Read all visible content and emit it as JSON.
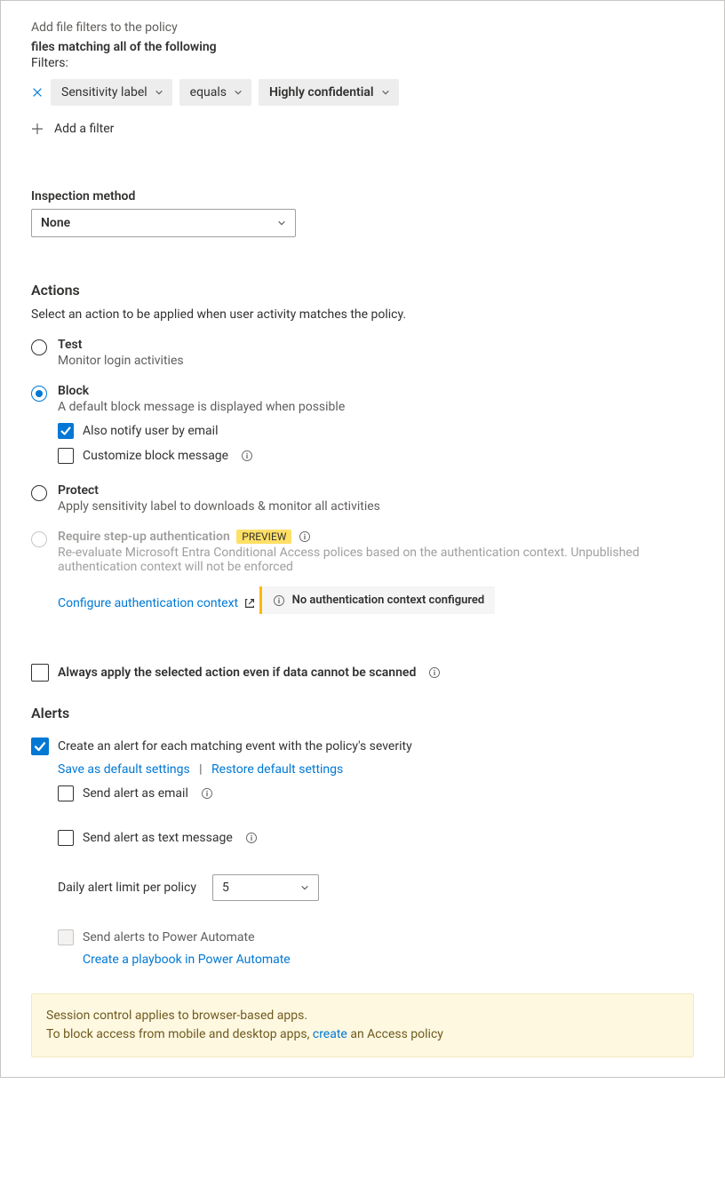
{
  "filters_header": "Add file filters to the policy",
  "filters_match": "files matching all of the following",
  "filters_label": "Filters:",
  "filter": {
    "field": "Sensitivity label",
    "op": "equals",
    "value": "Highly confidential"
  },
  "add_filter": "Add a filter",
  "inspection": {
    "label": "Inspection method",
    "value": "None"
  },
  "actions": {
    "title": "Actions",
    "desc": "Select an action to be applied when user activity matches the policy.",
    "test": {
      "title": "Test",
      "sub": "Monitor login activities"
    },
    "block": {
      "title": "Block",
      "sub": "A default block message is displayed when possible",
      "notify": "Also notify user by email",
      "customize": "Customize block message"
    },
    "protect": {
      "title": "Protect",
      "sub": "Apply sensitivity label to downloads & monitor all activities"
    },
    "stepup": {
      "title": "Require step-up authentication",
      "badge": "PREVIEW",
      "sub": "Re-evaluate Microsoft Entra Conditional Access polices based on the authentication context. Unpublished authentication context will not be enforced",
      "config_link": "Configure authentication context",
      "warn": "No authentication context configured"
    },
    "always_apply": "Always apply the selected action even if data cannot be scanned"
  },
  "alerts": {
    "title": "Alerts",
    "create": "Create an alert for each matching event with the policy's severity",
    "save_default": "Save as default settings",
    "restore_default": "Restore default settings",
    "send_email": "Send alert as email",
    "send_sms": "Send alert as text message",
    "daily_limit": "Daily alert limit per policy",
    "daily_limit_value": "5",
    "power_automate": "Send alerts to Power Automate",
    "playbook_link": "Create a playbook in Power Automate"
  },
  "note": {
    "line1": "Session control applies to browser-based apps.",
    "line2a": "To block access from mobile and desktop apps, ",
    "link": "create",
    "line2b": " an Access policy"
  }
}
